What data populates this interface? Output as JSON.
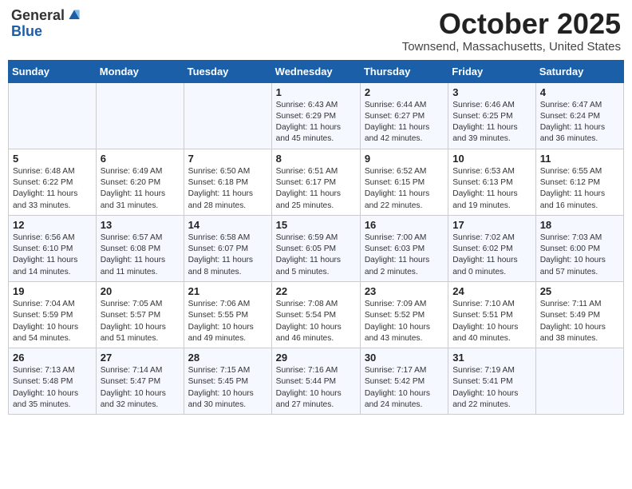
{
  "header": {
    "logo_line1": "General",
    "logo_line2": "Blue",
    "month": "October 2025",
    "location": "Townsend, Massachusetts, United States"
  },
  "weekdays": [
    "Sunday",
    "Monday",
    "Tuesday",
    "Wednesday",
    "Thursday",
    "Friday",
    "Saturday"
  ],
  "weeks": [
    [
      {
        "day": "",
        "info": ""
      },
      {
        "day": "",
        "info": ""
      },
      {
        "day": "",
        "info": ""
      },
      {
        "day": "1",
        "info": "Sunrise: 6:43 AM\nSunset: 6:29 PM\nDaylight: 11 hours\nand 45 minutes."
      },
      {
        "day": "2",
        "info": "Sunrise: 6:44 AM\nSunset: 6:27 PM\nDaylight: 11 hours\nand 42 minutes."
      },
      {
        "day": "3",
        "info": "Sunrise: 6:46 AM\nSunset: 6:25 PM\nDaylight: 11 hours\nand 39 minutes."
      },
      {
        "day": "4",
        "info": "Sunrise: 6:47 AM\nSunset: 6:24 PM\nDaylight: 11 hours\nand 36 minutes."
      }
    ],
    [
      {
        "day": "5",
        "info": "Sunrise: 6:48 AM\nSunset: 6:22 PM\nDaylight: 11 hours\nand 33 minutes."
      },
      {
        "day": "6",
        "info": "Sunrise: 6:49 AM\nSunset: 6:20 PM\nDaylight: 11 hours\nand 31 minutes."
      },
      {
        "day": "7",
        "info": "Sunrise: 6:50 AM\nSunset: 6:18 PM\nDaylight: 11 hours\nand 28 minutes."
      },
      {
        "day": "8",
        "info": "Sunrise: 6:51 AM\nSunset: 6:17 PM\nDaylight: 11 hours\nand 25 minutes."
      },
      {
        "day": "9",
        "info": "Sunrise: 6:52 AM\nSunset: 6:15 PM\nDaylight: 11 hours\nand 22 minutes."
      },
      {
        "day": "10",
        "info": "Sunrise: 6:53 AM\nSunset: 6:13 PM\nDaylight: 11 hours\nand 19 minutes."
      },
      {
        "day": "11",
        "info": "Sunrise: 6:55 AM\nSunset: 6:12 PM\nDaylight: 11 hours\nand 16 minutes."
      }
    ],
    [
      {
        "day": "12",
        "info": "Sunrise: 6:56 AM\nSunset: 6:10 PM\nDaylight: 11 hours\nand 14 minutes."
      },
      {
        "day": "13",
        "info": "Sunrise: 6:57 AM\nSunset: 6:08 PM\nDaylight: 11 hours\nand 11 minutes."
      },
      {
        "day": "14",
        "info": "Sunrise: 6:58 AM\nSunset: 6:07 PM\nDaylight: 11 hours\nand 8 minutes."
      },
      {
        "day": "15",
        "info": "Sunrise: 6:59 AM\nSunset: 6:05 PM\nDaylight: 11 hours\nand 5 minutes."
      },
      {
        "day": "16",
        "info": "Sunrise: 7:00 AM\nSunset: 6:03 PM\nDaylight: 11 hours\nand 2 minutes."
      },
      {
        "day": "17",
        "info": "Sunrise: 7:02 AM\nSunset: 6:02 PM\nDaylight: 11 hours\nand 0 minutes."
      },
      {
        "day": "18",
        "info": "Sunrise: 7:03 AM\nSunset: 6:00 PM\nDaylight: 10 hours\nand 57 minutes."
      }
    ],
    [
      {
        "day": "19",
        "info": "Sunrise: 7:04 AM\nSunset: 5:59 PM\nDaylight: 10 hours\nand 54 minutes."
      },
      {
        "day": "20",
        "info": "Sunrise: 7:05 AM\nSunset: 5:57 PM\nDaylight: 10 hours\nand 51 minutes."
      },
      {
        "day": "21",
        "info": "Sunrise: 7:06 AM\nSunset: 5:55 PM\nDaylight: 10 hours\nand 49 minutes."
      },
      {
        "day": "22",
        "info": "Sunrise: 7:08 AM\nSunset: 5:54 PM\nDaylight: 10 hours\nand 46 minutes."
      },
      {
        "day": "23",
        "info": "Sunrise: 7:09 AM\nSunset: 5:52 PM\nDaylight: 10 hours\nand 43 minutes."
      },
      {
        "day": "24",
        "info": "Sunrise: 7:10 AM\nSunset: 5:51 PM\nDaylight: 10 hours\nand 40 minutes."
      },
      {
        "day": "25",
        "info": "Sunrise: 7:11 AM\nSunset: 5:49 PM\nDaylight: 10 hours\nand 38 minutes."
      }
    ],
    [
      {
        "day": "26",
        "info": "Sunrise: 7:13 AM\nSunset: 5:48 PM\nDaylight: 10 hours\nand 35 minutes."
      },
      {
        "day": "27",
        "info": "Sunrise: 7:14 AM\nSunset: 5:47 PM\nDaylight: 10 hours\nand 32 minutes."
      },
      {
        "day": "28",
        "info": "Sunrise: 7:15 AM\nSunset: 5:45 PM\nDaylight: 10 hours\nand 30 minutes."
      },
      {
        "day": "29",
        "info": "Sunrise: 7:16 AM\nSunset: 5:44 PM\nDaylight: 10 hours\nand 27 minutes."
      },
      {
        "day": "30",
        "info": "Sunrise: 7:17 AM\nSunset: 5:42 PM\nDaylight: 10 hours\nand 24 minutes."
      },
      {
        "day": "31",
        "info": "Sunrise: 7:19 AM\nSunset: 5:41 PM\nDaylight: 10 hours\nand 22 minutes."
      },
      {
        "day": "",
        "info": ""
      }
    ]
  ]
}
